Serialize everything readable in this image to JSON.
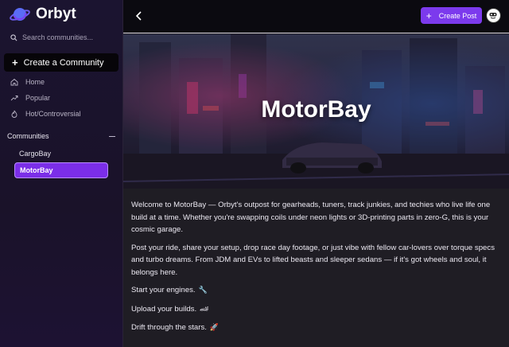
{
  "app": {
    "brand_name": "Orbyt"
  },
  "sidebar": {
    "search_placeholder": "Search communities...",
    "create_community_label": "Create a Community",
    "nav": [
      {
        "label": "Home",
        "icon": "home-icon"
      },
      {
        "label": "Popular",
        "icon": "trending-icon"
      },
      {
        "label": "Hot/Controversial",
        "icon": "flame-icon"
      }
    ],
    "communities_header": "Communities",
    "communities": [
      {
        "label": "CargoBay",
        "active": false
      },
      {
        "label": "MotorBay",
        "active": true
      }
    ]
  },
  "topbar": {
    "create_post_label": "Create Post"
  },
  "community": {
    "name": "MotorBay",
    "paragraphs": [
      "Welcome to MotorBay — Orbyt's outpost for gearheads, tuners, track junkies, and techies who live life one build at a time. Whether you're swapping coils under neon lights or 3D-printing parts in zero-G, this is your cosmic garage.",
      "Post your ride, share your setup, drop race day footage, or just vibe with fellow car-lovers over torque specs and turbo dreams. From JDM and EVs to lifted beasts and sleeper sedans — if it's got wheels and soul, it belongs here."
    ],
    "taglines": [
      {
        "text": "Start your engines.",
        "emoji": "🔧"
      },
      {
        "text": "Upload your builds.",
        "emoji": "🏎"
      },
      {
        "text": "Drift through the stars.",
        "emoji": "🚀"
      }
    ]
  },
  "colors": {
    "accent": "#7c3aed",
    "active_item": "#7b2ee8",
    "sidebar_bg": "#1b1430",
    "main_bg": "#1f1d24",
    "topbar_bg": "#0b0a10"
  }
}
